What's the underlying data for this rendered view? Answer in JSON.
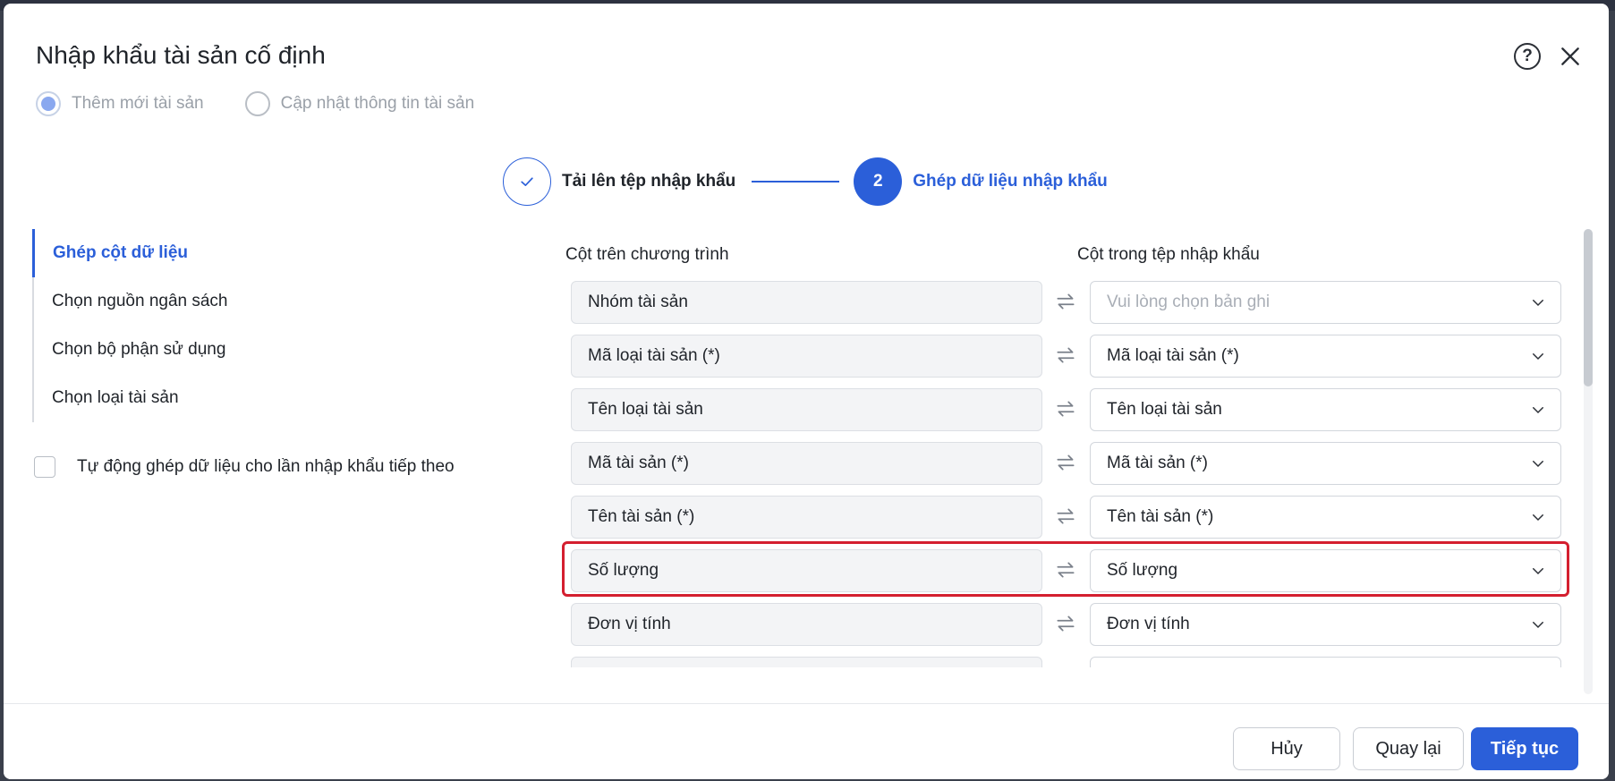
{
  "dialog": {
    "title": "Nhập khẩu tài sản cố định",
    "help_icon": "question-circle-icon",
    "close_icon": "close-icon"
  },
  "mode": {
    "options": [
      {
        "label": "Thêm mới tài sản",
        "checked": true
      },
      {
        "label": "Cập nhật thông tin tài sản",
        "checked": false
      }
    ]
  },
  "stepper": {
    "step1": {
      "label": "Tải lên tệp nhập khẩu",
      "status": "done"
    },
    "step2": {
      "number": "2",
      "label": "Ghép dữ liệu nhập khẩu",
      "status": "active"
    }
  },
  "left_nav": {
    "items": [
      {
        "label": "Ghép cột dữ liệu",
        "active": true
      },
      {
        "label": "Chọn nguồn ngân sách",
        "active": false
      },
      {
        "label": "Chọn bộ phận sử dụng",
        "active": false
      },
      {
        "label": "Chọn loại tài sản",
        "active": false
      }
    ]
  },
  "auto_match": {
    "label": "Tự động ghép dữ liệu cho lần nhập khẩu tiếp theo",
    "checked": false
  },
  "mapping": {
    "header_program": "Cột trên chương trình",
    "header_file": "Cột trong tệp nhập khẩu",
    "placeholder": "Vui lòng chọn bản ghi",
    "rows": [
      {
        "program": "Nhóm tài sản",
        "file": ""
      },
      {
        "program": "Mã loại tài sản (*)",
        "file": "Mã loại tài sản (*)"
      },
      {
        "program": "Tên loại tài sản",
        "file": "Tên loại tài sản"
      },
      {
        "program": "Mã tài sản (*)",
        "file": "Mã tài sản (*)"
      },
      {
        "program": "Tên tài sản (*)",
        "file": "Tên tài sản (*)"
      },
      {
        "program": "Số lượng",
        "file": "Số lượng"
      },
      {
        "program": "Đơn vị tính",
        "file": "Đơn vị tính"
      },
      {
        "program": "",
        "file": ""
      }
    ]
  },
  "footer": {
    "cancel_label": "Hủy",
    "back_label": "Quay lại",
    "next_label": "Tiếp tục"
  },
  "colors": {
    "primary": "#2b5fd9",
    "highlight": "#d41f2f"
  }
}
